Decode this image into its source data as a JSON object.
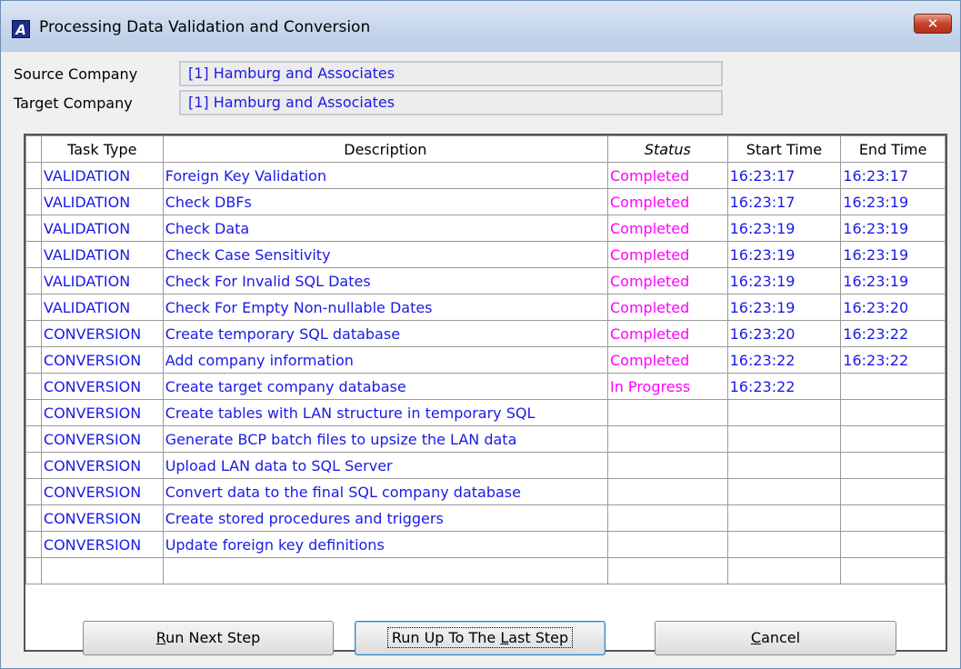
{
  "window": {
    "title": "Processing Data Validation and Conversion",
    "app_icon_letter": "A",
    "close_glyph": "✕"
  },
  "form": {
    "source_label": "Source Company",
    "source_value": "[1] Hamburg and Associates",
    "target_label": "Target Company",
    "target_value": "[1] Hamburg and Associates"
  },
  "grid": {
    "columns": [
      "Task Type",
      "Description",
      "Status",
      "Start Time",
      "End Time"
    ],
    "rows": [
      {
        "type": "VALIDATION",
        "desc": "Foreign Key Validation",
        "status": "Completed",
        "start": "16:23:17",
        "end": "16:23:17"
      },
      {
        "type": "VALIDATION",
        "desc": "Check DBFs",
        "status": "Completed",
        "start": "16:23:17",
        "end": "16:23:19"
      },
      {
        "type": "VALIDATION",
        "desc": "Check Data",
        "status": "Completed",
        "start": "16:23:19",
        "end": "16:23:19"
      },
      {
        "type": "VALIDATION",
        "desc": "Check Case Sensitivity",
        "status": "Completed",
        "start": "16:23:19",
        "end": "16:23:19"
      },
      {
        "type": "VALIDATION",
        "desc": "Check For Invalid SQL Dates",
        "status": "Completed",
        "start": "16:23:19",
        "end": "16:23:19"
      },
      {
        "type": "VALIDATION",
        "desc": "Check For Empty Non-nullable Dates",
        "status": "Completed",
        "start": "16:23:19",
        "end": "16:23:20"
      },
      {
        "type": "CONVERSION",
        "desc": "Create temporary SQL database",
        "status": "Completed",
        "start": "16:23:20",
        "end": "16:23:22"
      },
      {
        "type": "CONVERSION",
        "desc": "Add company information",
        "status": "Completed",
        "start": "16:23:22",
        "end": "16:23:22"
      },
      {
        "type": "CONVERSION",
        "desc": "Create target company database",
        "status": "In Progress",
        "start": "16:23:22",
        "end": ""
      },
      {
        "type": "CONVERSION",
        "desc": "Create tables with LAN structure in temporary SQL",
        "status": "",
        "start": "",
        "end": ""
      },
      {
        "type": "CONVERSION",
        "desc": "Generate BCP batch files to upsize the LAN data",
        "status": "",
        "start": "",
        "end": ""
      },
      {
        "type": "CONVERSION",
        "desc": "Upload LAN data to SQL Server",
        "status": "",
        "start": "",
        "end": ""
      },
      {
        "type": "CONVERSION",
        "desc": "Convert data to the final SQL company database",
        "status": "",
        "start": "",
        "end": ""
      },
      {
        "type": "CONVERSION",
        "desc": "Create stored procedures and triggers",
        "status": "",
        "start": "",
        "end": ""
      },
      {
        "type": "CONVERSION",
        "desc": "Update foreign key definitions",
        "status": "",
        "start": "",
        "end": ""
      },
      {
        "type": "",
        "desc": "",
        "status": "",
        "start": "",
        "end": ""
      }
    ]
  },
  "buttons": {
    "run_next": {
      "mnemonic": "R",
      "rest": "un Next Step"
    },
    "run_all": {
      "pre": "Run Up To The ",
      "mnemonic": "L",
      "rest": "ast Step"
    },
    "cancel": {
      "mnemonic": "C",
      "rest": "ancel"
    }
  },
  "colors": {
    "text_value": "#1a1ae6",
    "status_text": "#ff00ff",
    "close_button": "#c7432a"
  }
}
